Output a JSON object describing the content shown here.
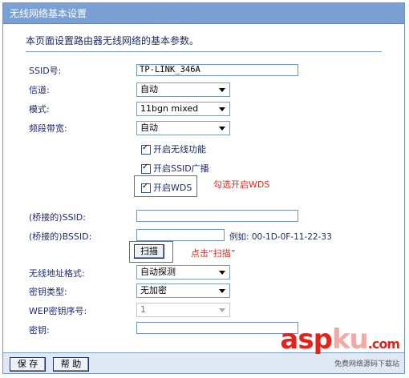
{
  "window": {
    "title": "无线网络基本设置"
  },
  "description": "本页面设置路由器无线网络的基本参数。",
  "fields": {
    "ssid": {
      "label": "SSID号:",
      "value": "TP-LINK_346A"
    },
    "channel": {
      "label": "信道:",
      "value": "自动"
    },
    "mode": {
      "label": "模式:",
      "value": "11bgn mixed"
    },
    "bandwidth": {
      "label": "频段带宽:",
      "value": "自动"
    }
  },
  "checkboxes": {
    "wireless": {
      "label": "开启无线功能",
      "checked": true
    },
    "ssid_broadcast": {
      "label": "开启SSID广播",
      "checked": true
    },
    "wds": {
      "label": "开启WDS",
      "checked": true
    }
  },
  "annotations": {
    "wds_note": "勾选开启WDS",
    "scan_note": "点击“扫描”"
  },
  "wds": {
    "bridged_ssid": {
      "label": "(桥接的)SSID:",
      "value": ""
    },
    "bridged_bssid": {
      "label": "(桥接的)BSSID:",
      "value": ""
    },
    "bssid_example": "例如: 00-1D-0F-11-22-33",
    "scan_button": "扫描",
    "address_format": {
      "label": "无线地址格式:",
      "value": "自动探测"
    },
    "key_type": {
      "label": "密钥类型:",
      "value": "无加密"
    },
    "wep_index": {
      "label": "WEP密钥序号:",
      "value": "1"
    },
    "key": {
      "label": "密钥:",
      "value": ""
    }
  },
  "footer": {
    "save_button": "保 存",
    "help_button": "帮 助"
  },
  "watermark": {
    "part_a": "asp",
    "part_b": "ku",
    "part_c": ".com",
    "sub": "免费网络源码下载站"
  }
}
